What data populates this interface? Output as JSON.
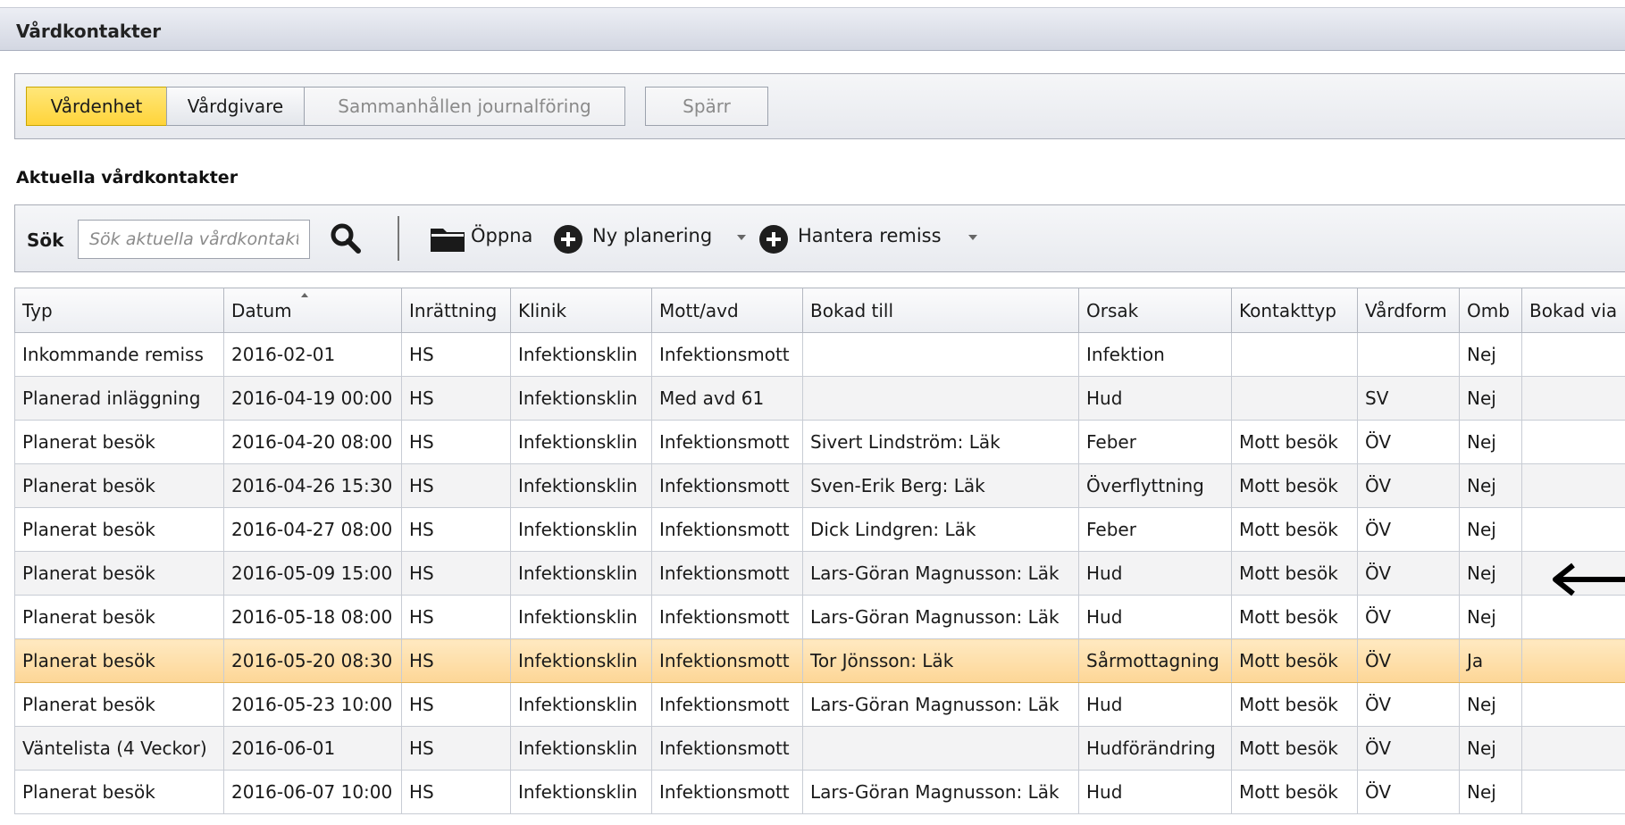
{
  "window": {
    "title": "Vårdkontakter"
  },
  "tabs": [
    {
      "label": "Vårdenhet",
      "state": "active"
    },
    {
      "label": "Vårdgivare",
      "state": "normal"
    },
    {
      "label": "Sammanhållen journalföring",
      "state": "disabled"
    }
  ],
  "spar_button": {
    "label": "Spärr"
  },
  "section": {
    "title": "Aktuella vårdkontakter"
  },
  "toolbar": {
    "search_label": "Sök",
    "search_placeholder": "Sök aktuella vårdkontakter",
    "search_icon": "magnifier-icon",
    "open_label": "Öppna",
    "open_icon": "folder-icon",
    "new_plan_label": "Ny planering",
    "remiss_label": "Hantera remiss",
    "plus_icon": "plus-circle-icon"
  },
  "table": {
    "columns": [
      "Typ",
      "Datum",
      "Inrättning",
      "Klinik",
      "Mott/avd",
      "Bokad till",
      "Orsak",
      "Kontakttyp",
      "Vårdform",
      "Omb",
      "Bokad via"
    ],
    "sorted_column": "Datum",
    "selected_row": 7,
    "rows": [
      [
        "Inkommande remiss",
        "2016-02-01",
        "HS",
        "Infektionsklin",
        "Infektionsmott",
        "",
        "Infektion",
        "",
        "",
        "Nej",
        ""
      ],
      [
        "Planerad inläggning",
        "2016-04-19 00:00",
        "HS",
        "Infektionsklin",
        "Med avd 61",
        "",
        "Hud",
        "",
        "SV",
        "Nej",
        ""
      ],
      [
        "Planerat besök",
        "2016-04-20 08:00",
        "HS",
        "Infektionsklin",
        "Infektionsmott",
        "Sivert Lindström: Läk",
        "Feber",
        "Mott besök",
        "ÖV",
        "Nej",
        ""
      ],
      [
        "Planerat besök",
        "2016-04-26 15:30",
        "HS",
        "Infektionsklin",
        "Infektionsmott",
        "Sven-Erik Berg: Läk",
        "Överflyttning",
        "Mott besök",
        "ÖV",
        "Nej",
        ""
      ],
      [
        "Planerat besök",
        "2016-04-27 08:00",
        "HS",
        "Infektionsklin",
        "Infektionsmott",
        "Dick Lindgren: Läk",
        "Feber",
        "Mott besök",
        "ÖV",
        "Nej",
        ""
      ],
      [
        "Planerat besök",
        "2016-05-09 15:00",
        "HS",
        "Infektionsklin",
        "Infektionsmott",
        "Lars-Göran Magnusson: Läk",
        "Hud",
        "Mott besök",
        "ÖV",
        "Nej",
        ""
      ],
      [
        "Planerat besök",
        "2016-05-18 08:00",
        "HS",
        "Infektionsklin",
        "Infektionsmott",
        "Lars-Göran Magnusson: Läk",
        "Hud",
        "Mott besök",
        "ÖV",
        "Nej",
        ""
      ],
      [
        "Planerat besök",
        "2016-05-20 08:30",
        "HS",
        "Infektionsklin",
        "Infektionsmott",
        "Tor Jönsson: Läk",
        "Sårmottagning",
        "Mott besök",
        "ÖV",
        "Ja",
        ""
      ],
      [
        "Planerat besök",
        "2016-05-23 10:00",
        "HS",
        "Infektionsklin",
        "Infektionsmott",
        "Lars-Göran Magnusson: Läk",
        "Hud",
        "Mott besök",
        "ÖV",
        "Nej",
        ""
      ],
      [
        "Väntelista (4 Veckor)",
        "2016-06-01",
        "HS",
        "Infektionsklin",
        "Infektionsmott",
        "",
        "Hudförändring",
        "Mott besök",
        "ÖV",
        "Nej",
        ""
      ],
      [
        "Planerat besök",
        "2016-06-07 10:00",
        "HS",
        "Infektionsklin",
        "Infektionsmott",
        "Lars-Göran Magnusson: Läk",
        "Hud",
        "Mott besök",
        "ÖV",
        "Nej",
        ""
      ]
    ]
  },
  "annotation": {
    "icon": "left-arrow-icon",
    "color": "#000000"
  }
}
